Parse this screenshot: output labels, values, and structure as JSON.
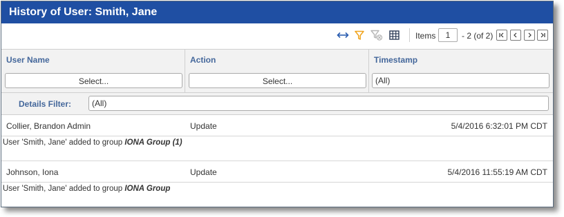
{
  "window": {
    "title": "History of User: Smith, Jane"
  },
  "toolbar": {
    "icons": [
      "expand-arrows-icon",
      "filter-icon",
      "clear-filter-icon",
      "grid-columns-icon"
    ],
    "colors": {
      "expand": "#2a5db0",
      "filter": "#f0a31b",
      "disabled": "#b5b5b5"
    },
    "pager": {
      "items_label": "Items",
      "current_page": "1",
      "range_text": "- 2 (of 2)"
    }
  },
  "table": {
    "columns": [
      "User Name",
      "Action",
      "Timestamp"
    ],
    "filters": {
      "user_name": "Select...",
      "action": "Select...",
      "timestamp": "(All)",
      "details_label": "Details Filter:",
      "details_value": "(All)"
    },
    "rows": [
      {
        "user_name": "Collier, Brandon Admin",
        "action": "Update",
        "timestamp": "5/4/2016 6:32:01 PM CDT",
        "detail_prefix": "User 'Smith, Jane' added to group ",
        "detail_group": "IONA Group (1)"
      },
      {
        "user_name": "Johnson, Iona",
        "action": "Update",
        "timestamp": "5/4/2016 11:55:19 AM CDT",
        "detail_prefix": "User 'Smith, Jane' added to group ",
        "detail_group": "IONA Group"
      }
    ]
  }
}
